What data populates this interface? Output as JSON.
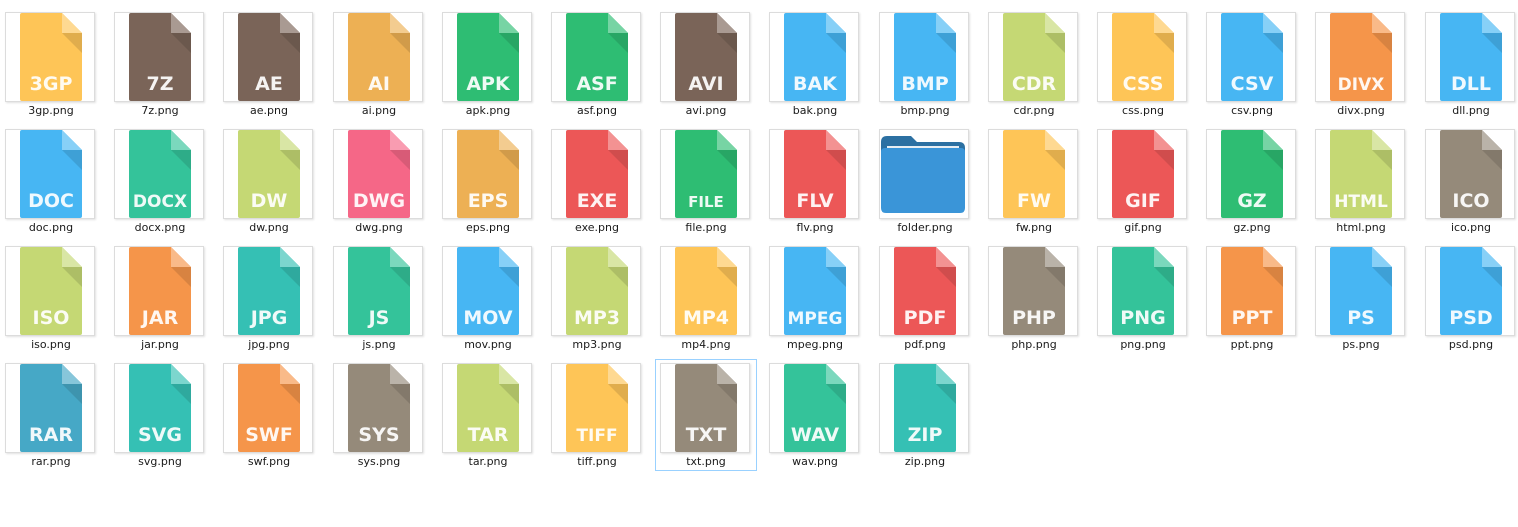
{
  "view": "large-icons",
  "selected_item": "txt.png",
  "items": [
    {
      "file": "3gp.png",
      "label": "3GP",
      "color": "#fec557",
      "icon": "document-icon"
    },
    {
      "file": "7z.png",
      "label": "7Z",
      "color": "#7a6458",
      "icon": "document-icon"
    },
    {
      "file": "ae.png",
      "label": "AE",
      "color": "#7a6458",
      "icon": "document-icon"
    },
    {
      "file": "ai.png",
      "label": "AI",
      "color": "#edb054",
      "icon": "document-icon"
    },
    {
      "file": "apk.png",
      "label": "APK",
      "color": "#2ebd73",
      "icon": "document-icon"
    },
    {
      "file": "asf.png",
      "label": "ASF",
      "color": "#2ebd73",
      "icon": "document-icon"
    },
    {
      "file": "avi.png",
      "label": "AVI",
      "color": "#7a6458",
      "icon": "document-icon"
    },
    {
      "file": "bak.png",
      "label": "BAK",
      "color": "#47b6f3",
      "icon": "document-icon"
    },
    {
      "file": "bmp.png",
      "label": "BMP",
      "color": "#47b6f3",
      "icon": "document-icon"
    },
    {
      "file": "cdr.png",
      "label": "CDR",
      "color": "#c5d874",
      "icon": "document-icon"
    },
    {
      "file": "css.png",
      "label": "CSS",
      "color": "#fec557",
      "icon": "document-icon"
    },
    {
      "file": "csv.png",
      "label": "CSV",
      "color": "#47b6f3",
      "icon": "document-icon"
    },
    {
      "file": "divx.png",
      "label": "DIVX",
      "color": "#f5954a",
      "icon": "document-icon"
    },
    {
      "file": "dll.png",
      "label": "DLL",
      "color": "#47b6f3",
      "icon": "document-icon"
    },
    {
      "file": "doc.png",
      "label": "DOC",
      "color": "#47b6f3",
      "icon": "document-icon"
    },
    {
      "file": "docx.png",
      "label": "DOCX",
      "color": "#34c39a",
      "icon": "document-icon"
    },
    {
      "file": "dw.png",
      "label": "DW",
      "color": "#c5d874",
      "icon": "document-icon"
    },
    {
      "file": "dwg.png",
      "label": "DWG",
      "color": "#f56787",
      "icon": "document-icon"
    },
    {
      "file": "eps.png",
      "label": "EPS",
      "color": "#edb054",
      "icon": "document-icon"
    },
    {
      "file": "exe.png",
      "label": "EXE",
      "color": "#ec5757",
      "icon": "document-icon"
    },
    {
      "file": "file.png",
      "label": "FILE",
      "color": "#2ebd73",
      "icon": "document-icon"
    },
    {
      "file": "flv.png",
      "label": "FLV",
      "color": "#ec5757",
      "icon": "document-icon"
    },
    {
      "file": "folder.png",
      "label": "",
      "color": "#3a95d8",
      "icon": "folder-icon"
    },
    {
      "file": "fw.png",
      "label": "FW",
      "color": "#fec557",
      "icon": "document-icon"
    },
    {
      "file": "gif.png",
      "label": "GIF",
      "color": "#ec5757",
      "icon": "document-icon"
    },
    {
      "file": "gz.png",
      "label": "GZ",
      "color": "#2ebd73",
      "icon": "document-icon"
    },
    {
      "file": "html.png",
      "label": "HTML",
      "color": "#c5d874",
      "icon": "document-icon"
    },
    {
      "file": "ico.png",
      "label": "ICO",
      "color": "#958a7a",
      "icon": "document-icon"
    },
    {
      "file": "iso.png",
      "label": "ISO",
      "color": "#c5d874",
      "icon": "document-icon"
    },
    {
      "file": "jar.png",
      "label": "JAR",
      "color": "#f5954a",
      "icon": "document-icon"
    },
    {
      "file": "jpg.png",
      "label": "JPG",
      "color": "#35c0b4",
      "icon": "document-icon"
    },
    {
      "file": "js.png",
      "label": "JS",
      "color": "#34c39a",
      "icon": "document-icon"
    },
    {
      "file": "mov.png",
      "label": "MOV",
      "color": "#47b6f3",
      "icon": "document-icon"
    },
    {
      "file": "mp3.png",
      "label": "MP3",
      "color": "#c5d874",
      "icon": "document-icon"
    },
    {
      "file": "mp4.png",
      "label": "MP4",
      "color": "#fec557",
      "icon": "document-icon"
    },
    {
      "file": "mpeg.png",
      "label": "MPEG",
      "color": "#47b6f3",
      "icon": "document-icon"
    },
    {
      "file": "pdf.png",
      "label": "PDF",
      "color": "#ec5757",
      "icon": "document-icon"
    },
    {
      "file": "php.png",
      "label": "PHP",
      "color": "#958a7a",
      "icon": "document-icon"
    },
    {
      "file": "png.png",
      "label": "PNG",
      "color": "#34c39a",
      "icon": "document-icon"
    },
    {
      "file": "ppt.png",
      "label": "PPT",
      "color": "#f5954a",
      "icon": "document-icon"
    },
    {
      "file": "ps.png",
      "label": "PS",
      "color": "#47b6f3",
      "icon": "document-icon"
    },
    {
      "file": "psd.png",
      "label": "PSD",
      "color": "#47b6f3",
      "icon": "document-icon"
    },
    {
      "file": "rar.png",
      "label": "RAR",
      "color": "#46a8c6",
      "icon": "document-icon"
    },
    {
      "file": "svg.png",
      "label": "SVG",
      "color": "#35c0b4",
      "icon": "document-icon"
    },
    {
      "file": "swf.png",
      "label": "SWF",
      "color": "#f5954a",
      "icon": "document-icon"
    },
    {
      "file": "sys.png",
      "label": "SYS",
      "color": "#958a7a",
      "icon": "document-icon"
    },
    {
      "file": "tar.png",
      "label": "TAR",
      "color": "#c5d874",
      "icon": "document-icon"
    },
    {
      "file": "tiff.png",
      "label": "TIFF",
      "color": "#fec557",
      "icon": "document-icon"
    },
    {
      "file": "txt.png",
      "label": "TXT",
      "color": "#958a7a",
      "icon": "document-icon"
    },
    {
      "file": "wav.png",
      "label": "WAV",
      "color": "#34c39a",
      "icon": "document-icon"
    },
    {
      "file": "zip.png",
      "label": "ZIP",
      "color": "#35c0b4",
      "icon": "document-icon"
    }
  ]
}
